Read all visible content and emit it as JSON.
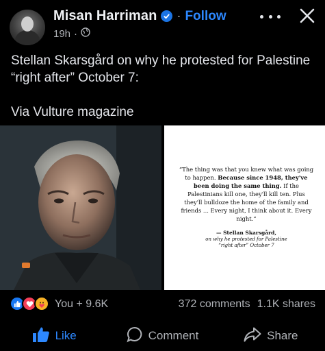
{
  "post": {
    "author": "Misan  Harriman",
    "separator": "·",
    "follow_label": "Follow",
    "time": "19h",
    "separator2": "·",
    "text_line1": "Stellan Skarsgård on why he protested for Palestine “right after” October 7:",
    "text_line2": "Via Vulture magazine"
  },
  "image": {
    "quote_pre": "“The thing was that you knew what was going to happen.",
    "quote_bold": "Because since 1948, they've been doing the same thing.",
    "quote_post": "If the Palestinians kill one, they'll kill ten. Plus they'll bulldoze the home of the family and friends ... Every night, I think about it. Every night.”",
    "attribution": "— Stellan Skarsgård,",
    "context_line1": "on why he protested for Palestine",
    "context_line2": "“right after” October 7"
  },
  "engagement": {
    "reactions_label": "You + 9.6K",
    "comments": "372 comments",
    "shares": "1.1K shares"
  },
  "actions": {
    "like": "Like",
    "comment": "Comment",
    "share": "Share"
  },
  "icons": [
    "verified-badge-icon",
    "globe-icon",
    "more-icon",
    "close-icon",
    "like-reaction-icon",
    "love-reaction-icon",
    "care-reaction-icon",
    "thumbs-up-icon",
    "comment-bubble-icon",
    "share-arrow-icon"
  ],
  "colors": {
    "accent": "#2d88ff",
    "background": "#000000",
    "muted": "#b0b3b8"
  }
}
